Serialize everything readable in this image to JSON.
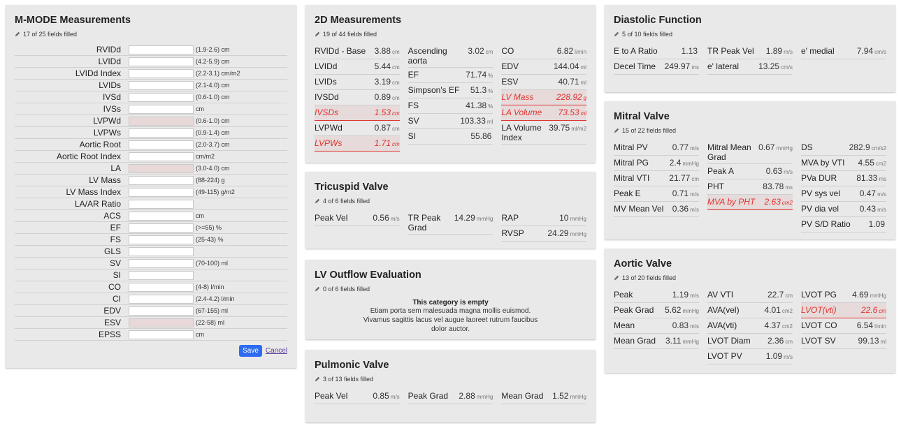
{
  "mmode": {
    "title": "M-MODE Measurements",
    "status": "17 of 25 fields filled",
    "fields": [
      {
        "label": "RVIDd",
        "range": "(1.9-2.6) cm",
        "warn": false
      },
      {
        "label": "LVIDd",
        "range": "(4.2-5.9) cm",
        "warn": false
      },
      {
        "label": "LVIDd Index",
        "range": "(2.2-3.1) cm/m2",
        "warn": false
      },
      {
        "label": "LVIDs",
        "range": "(2.1-4.0) cm",
        "warn": false
      },
      {
        "label": "IVSd",
        "range": "(0.6-1.0) cm",
        "warn": false
      },
      {
        "label": "IVSs",
        "range": "cm",
        "warn": false
      },
      {
        "label": "LVPWd",
        "range": "(0.6-1.0) cm",
        "warn": true
      },
      {
        "label": "LVPWs",
        "range": "(0.9-1.4) cm",
        "warn": false
      },
      {
        "label": "Aortic Root",
        "range": "(2.0-3.7) cm",
        "warn": false
      },
      {
        "label": "Aortic Root Index",
        "range": "cm/m2",
        "warn": false
      },
      {
        "label": "LA",
        "range": "(3.0-4.0) cm",
        "warn": true
      },
      {
        "label": "LV Mass",
        "range": "(88-224) g",
        "warn": false
      },
      {
        "label": "LV Mass Index",
        "range": "(49-115) g/m2",
        "warn": false
      },
      {
        "label": "LA/AR Ratio",
        "range": "",
        "warn": false
      },
      {
        "label": "ACS",
        "range": "cm",
        "warn": false
      },
      {
        "label": "EF",
        "range": "(>=55) %",
        "warn": false
      },
      {
        "label": "FS",
        "range": "(25-43) %",
        "warn": false
      },
      {
        "label": "GLS",
        "range": "",
        "warn": false
      },
      {
        "label": "SV",
        "range": "(70-100) ml",
        "warn": false
      },
      {
        "label": "SI",
        "range": "",
        "warn": false
      },
      {
        "label": "CO",
        "range": "(4-8) l/min",
        "warn": false
      },
      {
        "label": "CI",
        "range": "(2.4-4.2) l/min",
        "warn": false
      },
      {
        "label": "EDV",
        "range": "(67-155) ml",
        "warn": false
      },
      {
        "label": "ESV",
        "range": "(22-58) ml",
        "warn": true
      },
      {
        "label": "EPSS",
        "range": "cm",
        "warn": false
      }
    ],
    "save_label": "Save",
    "cancel_label": "Cancel"
  },
  "twod": {
    "title": "2D Measurements",
    "status": "19 of 44 fields filled",
    "columns": [
      [
        {
          "label": "RVIDd - Base",
          "value": "3.88",
          "unit": "cm",
          "alert": false
        },
        {
          "label": "LVIDd",
          "value": "5.44",
          "unit": "cm",
          "alert": false
        },
        {
          "label": "LVIDs",
          "value": "3.19",
          "unit": "cm",
          "alert": false
        },
        {
          "label": "IVSDd",
          "value": "0.89",
          "unit": "cm",
          "alert": false
        },
        {
          "label": "IVSDs",
          "value": "1.53",
          "unit": "cm",
          "alert": true
        },
        {
          "label": "LVPWd",
          "value": "0.87",
          "unit": "cm",
          "alert": false
        },
        {
          "label": "LVPWs",
          "value": "1.71",
          "unit": "cm",
          "alert": true
        }
      ],
      [
        {
          "label": "Ascending aorta",
          "value": "3.02",
          "unit": "cm",
          "alert": false
        },
        {
          "label": "EF",
          "value": "71.74",
          "unit": "%",
          "alert": false
        },
        {
          "label": "Simpson's EF",
          "value": "51.3",
          "unit": "%",
          "alert": false
        },
        {
          "label": "FS",
          "value": "41.38",
          "unit": "%",
          "alert": false
        },
        {
          "label": "SV",
          "value": "103.33",
          "unit": "ml",
          "alert": false
        },
        {
          "label": "SI",
          "value": "55.86",
          "unit": "",
          "alert": false
        }
      ],
      [
        {
          "label": "CO",
          "value": "6.82",
          "unit": "l/min",
          "alert": false
        },
        {
          "label": "EDV",
          "value": "144.04",
          "unit": "ml",
          "alert": false
        },
        {
          "label": "ESV",
          "value": "40.71",
          "unit": "ml",
          "alert": false
        },
        {
          "label": "LV Mass",
          "value": "228.92",
          "unit": "g",
          "alert": true
        },
        {
          "label": "LA Volume",
          "value": "73.53",
          "unit": "ml",
          "alert": true
        },
        {
          "label": "LA Volume Index",
          "value": "39.75",
          "unit": "ml/m2",
          "alert": false
        }
      ]
    ]
  },
  "tricuspid": {
    "title": "Tricuspid Valve",
    "status": "4 of 6 fields filled",
    "columns": [
      [
        {
          "label": "Peak Vel",
          "value": "0.56",
          "unit": "m/s",
          "alert": false
        }
      ],
      [
        {
          "label": "TR Peak Grad",
          "value": "14.29",
          "unit": "mmHg",
          "alert": false
        }
      ],
      [
        {
          "label": "RAP",
          "value": "10",
          "unit": "mmHg",
          "alert": false
        },
        {
          "label": "RVSP",
          "value": "24.29",
          "unit": "mmHg",
          "alert": false
        }
      ]
    ]
  },
  "lvot": {
    "title": "LV Outflow Evaluation",
    "status": "0 of 6 fields filled",
    "empty_title": "This category is empty",
    "empty_text": "Etiam porta sem malesuada magna mollis euismod. Vivamus sagittis lacus vel augue laoreet rutrum faucibus dolor auctor."
  },
  "pulmonic": {
    "title": "Pulmonic Valve",
    "status": "3 of 13 fields filled",
    "columns": [
      [
        {
          "label": "Peak Vel",
          "value": "0.85",
          "unit": "m/s",
          "alert": false
        }
      ],
      [
        {
          "label": "Peak Grad",
          "value": "2.88",
          "unit": "mmHg",
          "alert": false
        }
      ],
      [
        {
          "label": "Mean Grad",
          "value": "1.52",
          "unit": "mmHg",
          "alert": false
        }
      ]
    ]
  },
  "diastolic": {
    "title": "Diastolic Function",
    "status": "5 of 10 fields filled",
    "columns": [
      [
        {
          "label": "E to A Ratio",
          "value": "1.13",
          "unit": "",
          "alert": false
        },
        {
          "label": "Decel Time",
          "value": "249.97",
          "unit": "ms",
          "alert": false
        }
      ],
      [
        {
          "label": "TR Peak Vel",
          "value": "1.89",
          "unit": "m/s",
          "alert": false
        },
        {
          "label": "e' lateral",
          "value": "13.25",
          "unit": "cm/s",
          "alert": false
        }
      ],
      [
        {
          "label": "e' medial",
          "value": "7.94",
          "unit": "cm/s",
          "alert": false
        }
      ]
    ]
  },
  "mitral": {
    "title": "Mitral Valve",
    "status": "15 of 22 fields filled",
    "columns": [
      [
        {
          "label": "Mitral PV",
          "value": "0.77",
          "unit": "m/s",
          "alert": false
        },
        {
          "label": "Mitral PG",
          "value": "2.4",
          "unit": "mmHg",
          "alert": false
        },
        {
          "label": "Mitral VTI",
          "value": "21.77",
          "unit": "cm",
          "alert": false
        },
        {
          "label": "Peak E",
          "value": "0.71",
          "unit": "m/s",
          "alert": false
        },
        {
          "label": "MV Mean Vel",
          "value": "0.36",
          "unit": "m/s",
          "alert": false
        }
      ],
      [
        {
          "label": "Mitral Mean Grad",
          "value": "0.67",
          "unit": "mmHg",
          "alert": false
        },
        {
          "label": "Peak A",
          "value": "0.63",
          "unit": "m/s",
          "alert": false
        },
        {
          "label": "PHT",
          "value": "83.78",
          "unit": "ms",
          "alert": false
        },
        {
          "label": "MVA by PHT",
          "value": "2.63",
          "unit": "cm2",
          "alert": true
        }
      ],
      [
        {
          "label": "DS",
          "value": "282.9",
          "unit": "cm/s2",
          "alert": false
        },
        {
          "label": "MVA by VTI",
          "value": "4.55",
          "unit": "cm2",
          "alert": false
        },
        {
          "label": "PVa DUR",
          "value": "81.33",
          "unit": "ms",
          "alert": false
        },
        {
          "label": "PV sys vel",
          "value": "0.47",
          "unit": "m/s",
          "alert": false
        },
        {
          "label": "PV dia vel",
          "value": "0.43",
          "unit": "m/s",
          "alert": false
        },
        {
          "label": "PV S/D Ratio",
          "value": "1.09",
          "unit": "",
          "alert": false
        }
      ]
    ]
  },
  "aortic": {
    "title": "Aortic Valve",
    "status": "13 of 20 fields filled",
    "columns": [
      [
        {
          "label": "Peak",
          "value": "1.19",
          "unit": "m/s",
          "alert": false
        },
        {
          "label": "Peak Grad",
          "value": "5.62",
          "unit": "mmHg",
          "alert": false
        },
        {
          "label": "Mean",
          "value": "0.83",
          "unit": "m/s",
          "alert": false
        },
        {
          "label": "Mean Grad",
          "value": "3.11",
          "unit": "mmHg",
          "alert": false
        }
      ],
      [
        {
          "label": "AV VTI",
          "value": "22.7",
          "unit": "cm",
          "alert": false
        },
        {
          "label": "AVA(vel)",
          "value": "4.01",
          "unit": "cm2",
          "alert": false
        },
        {
          "label": "AVA(vti)",
          "value": "4.37",
          "unit": "cm2",
          "alert": false
        },
        {
          "label": "LVOT Diam",
          "value": "2.36",
          "unit": "cm",
          "alert": false
        },
        {
          "label": "LVOT PV",
          "value": "1.09",
          "unit": "m/s",
          "alert": false
        }
      ],
      [
        {
          "label": "LVOT PG",
          "value": "4.69",
          "unit": "mmHg",
          "alert": false
        },
        {
          "label": "LVOT(vti)",
          "value": "22.6",
          "unit": "cm",
          "alert": true
        },
        {
          "label": "LVOT CO",
          "value": "6.54",
          "unit": "l/min",
          "alert": false
        },
        {
          "label": "LVOT SV",
          "value": "99.13",
          "unit": "ml",
          "alert": false
        }
      ]
    ]
  }
}
